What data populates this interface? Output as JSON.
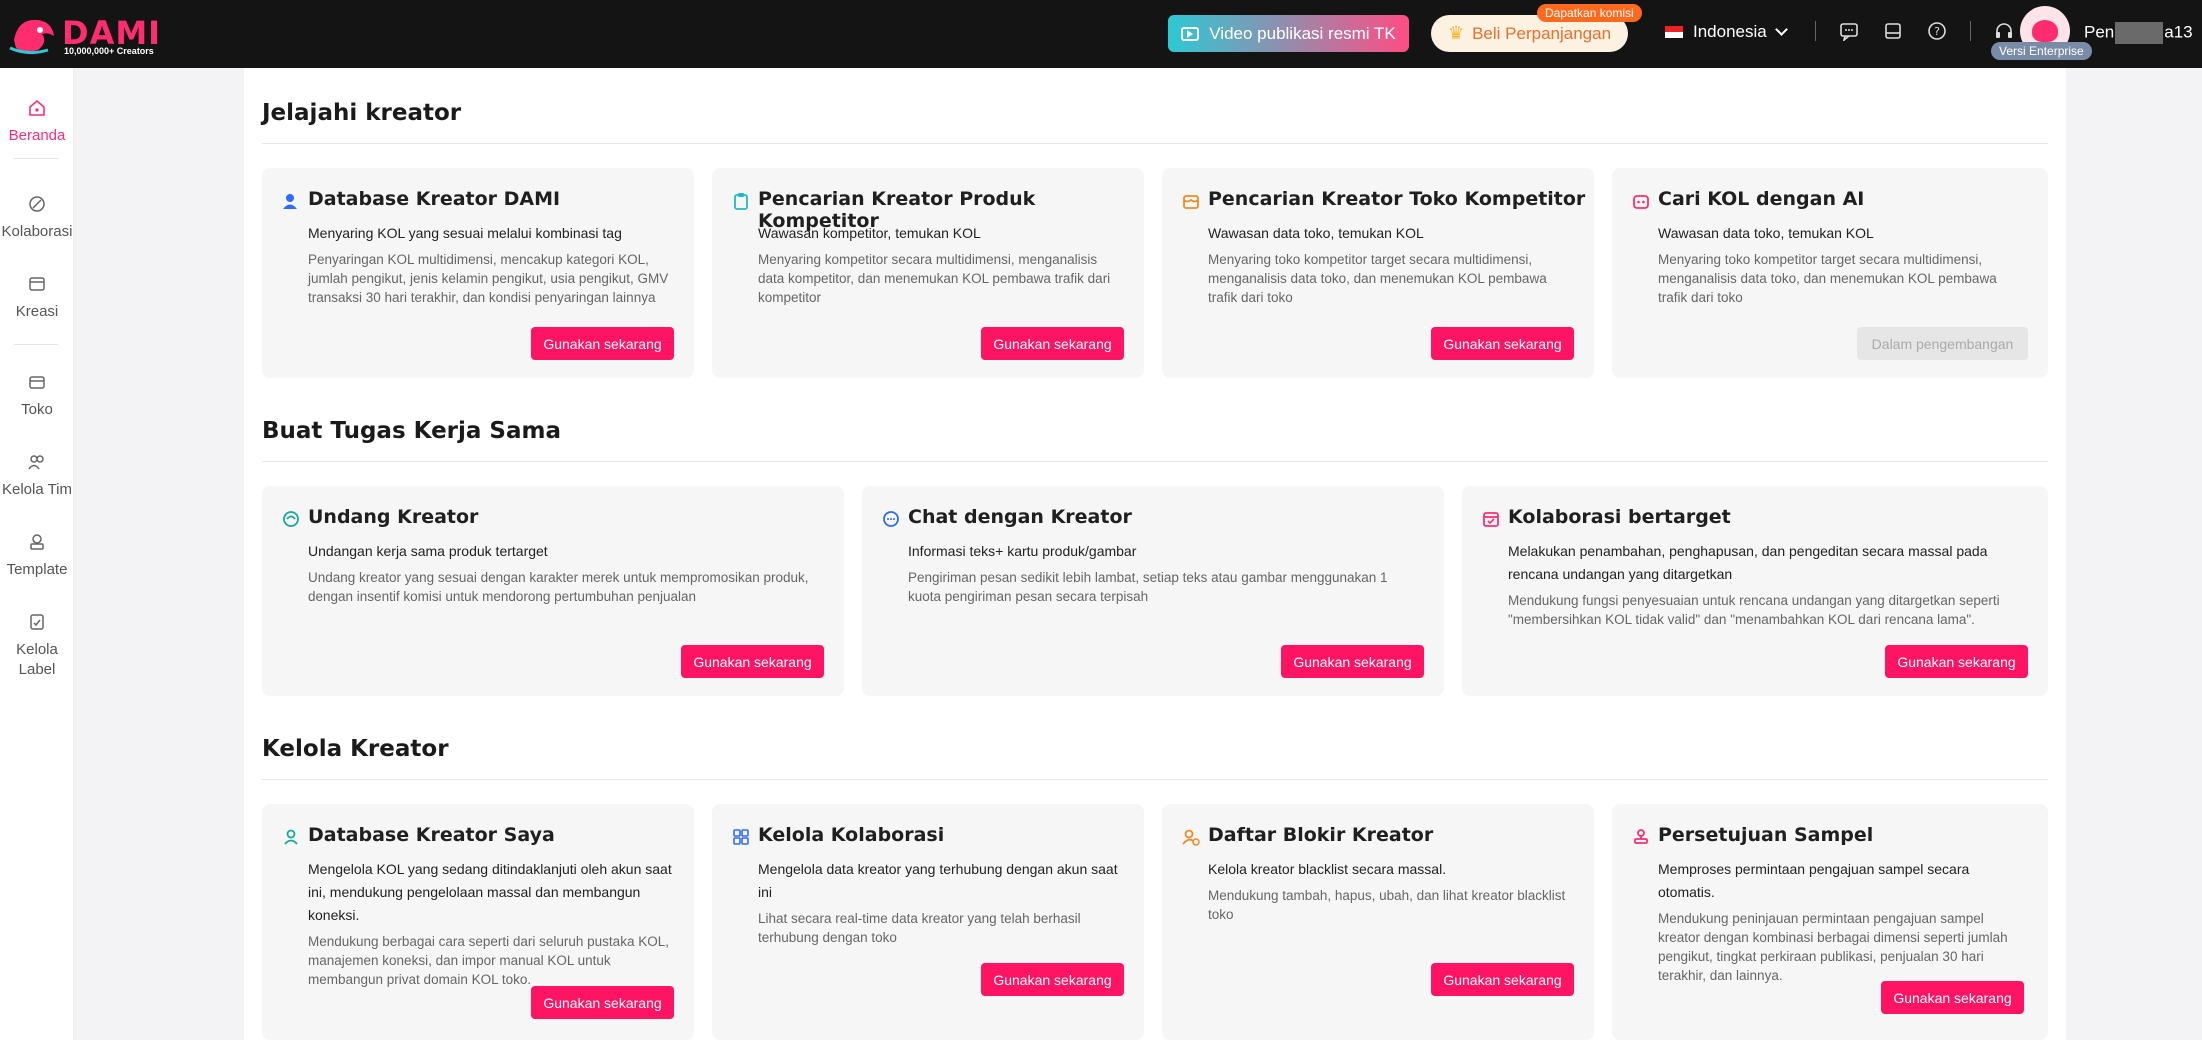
{
  "header": {
    "logo_text": "DAMI",
    "logo_sub": "10,000,000+ Creators",
    "video_button": "Video publikasi resmi TK",
    "renew_button": "Beli Perpanjangan",
    "commission_badge": "Dapatkan komisi",
    "language": "Indonesia",
    "enterprise_badge": "Versi Enterprise",
    "username_prefix": "Pen",
    "username_suffix": "a13..."
  },
  "sidebar": {
    "items": [
      {
        "label": "Beranda",
        "icon": "home-icon"
      },
      {
        "label": "Kolaborasi",
        "icon": "collab-icon"
      },
      {
        "label": "Kreasi",
        "icon": "create-icon"
      },
      {
        "label": "Toko",
        "icon": "shop-icon"
      },
      {
        "label": "Kelola Tim",
        "icon": "team-icon"
      },
      {
        "label": "Template",
        "icon": "template-icon"
      },
      {
        "label": "Kelola Label",
        "icon": "label-icon"
      }
    ]
  },
  "sections": {
    "explore": {
      "title": "Jelajahi kreator",
      "cards": [
        {
          "title": "Database Kreator DAMI",
          "sub": "Menyaring KOL yang sesuai melalui kombinasi tag",
          "desc": "Penyaringan KOL multidimensi, mencakup kategori KOL, jumlah pengikut, jenis kelamin pengikut, usia pengikut, GMV transaksi 30 hari terakhir, dan kondisi penyaringan lainnya",
          "button": "Gunakan sekarang"
        },
        {
          "title": "Pencarian Kreator Produk Kompetitor",
          "sub": "Wawasan kompetitor, temukan KOL",
          "desc": "Menyaring kompetitor secara multidimensi, menganalisis data kompetitor, dan menemukan KOL pembawa trafik dari kompetitor",
          "button": "Gunakan sekarang"
        },
        {
          "title": "Pencarian Kreator Toko Kompetitor",
          "sub": "Wawasan data toko, temukan KOL",
          "desc": "Menyaring toko kompetitor target secara multidimensi, menganalisis data toko, dan menemukan KOL pembawa trafik dari toko",
          "button": "Gunakan sekarang"
        },
        {
          "title": "Cari KOL dengan AI",
          "sub": "Wawasan data toko, temukan KOL",
          "desc": "Menyaring toko kompetitor target secara multidimensi, menganalisis data toko, dan menemukan KOL pembawa trafik dari toko",
          "button": "Dalam pengembangan"
        }
      ]
    },
    "tasks": {
      "title": "Buat Tugas Kerja Sama",
      "cards": [
        {
          "title": "Undang Kreator",
          "sub": "Undangan kerja sama produk tertarget",
          "desc": "Undang kreator yang sesuai dengan karakter merek untuk mempromosikan produk, dengan insentif komisi untuk mendorong pertumbuhan penjualan",
          "button": "Gunakan sekarang"
        },
        {
          "title": "Chat dengan Kreator",
          "sub": "Informasi teks+ kartu produk/gambar",
          "desc": "Pengiriman pesan sedikit lebih lambat, setiap teks atau gambar menggunakan 1 kuota pengiriman pesan secara terpisah",
          "button": "Gunakan sekarang"
        },
        {
          "title": "Kolaborasi bertarget",
          "sub": "Melakukan penambahan, penghapusan, dan pengeditan secara massal pada rencana undangan yang ditargetkan",
          "desc": "Mendukung fungsi penyesuaian untuk rencana undangan yang ditargetkan seperti \"membersihkan KOL tidak valid\" dan \"menambahkan KOL dari rencana lama\".",
          "button": "Gunakan sekarang"
        }
      ]
    },
    "manage": {
      "title": "Kelola Kreator",
      "cards": [
        {
          "title": "Database Kreator Saya",
          "sub": "Mengelola KOL yang sedang ditindaklanjuti oleh akun saat ini, mendukung pengelolaan massal dan membangun koneksi.",
          "desc": "Mendukung berbagai cara seperti dari seluruh pustaka KOL, manajemen koneksi, dan impor manual KOL untuk membangun privat domain KOL toko.",
          "button": "Gunakan sekarang"
        },
        {
          "title": "Kelola Kolaborasi",
          "sub": "Mengelola data kreator yang terhubung dengan akun saat ini",
          "desc": "Lihat secara real-time data kreator yang telah berhasil terhubung dengan toko",
          "button": "Gunakan sekarang"
        },
        {
          "title": "Daftar Blokir Kreator",
          "sub": "Kelola kreator blacklist secara massal.",
          "desc": "Mendukung tambah, hapus, ubah, dan lihat kreator blacklist toko",
          "button": "Gunakan sekarang"
        },
        {
          "title": "Persetujuan Sampel",
          "sub": "Memproses permintaan pengajuan sampel secara otomatis.",
          "desc": "Mendukung peninjauan permintaan pengajuan sampel kreator dengan kombinasi berbagai dimensi seperti jumlah pengikut, tingkat perkiraan publikasi, penjualan 30 hari terakhir, dan lainnya.",
          "button": "Gunakan sekarang"
        }
      ]
    }
  },
  "colors": {
    "accent": "#ff1463",
    "topbar": "#141414",
    "card_bg": "#f6f6f7"
  }
}
